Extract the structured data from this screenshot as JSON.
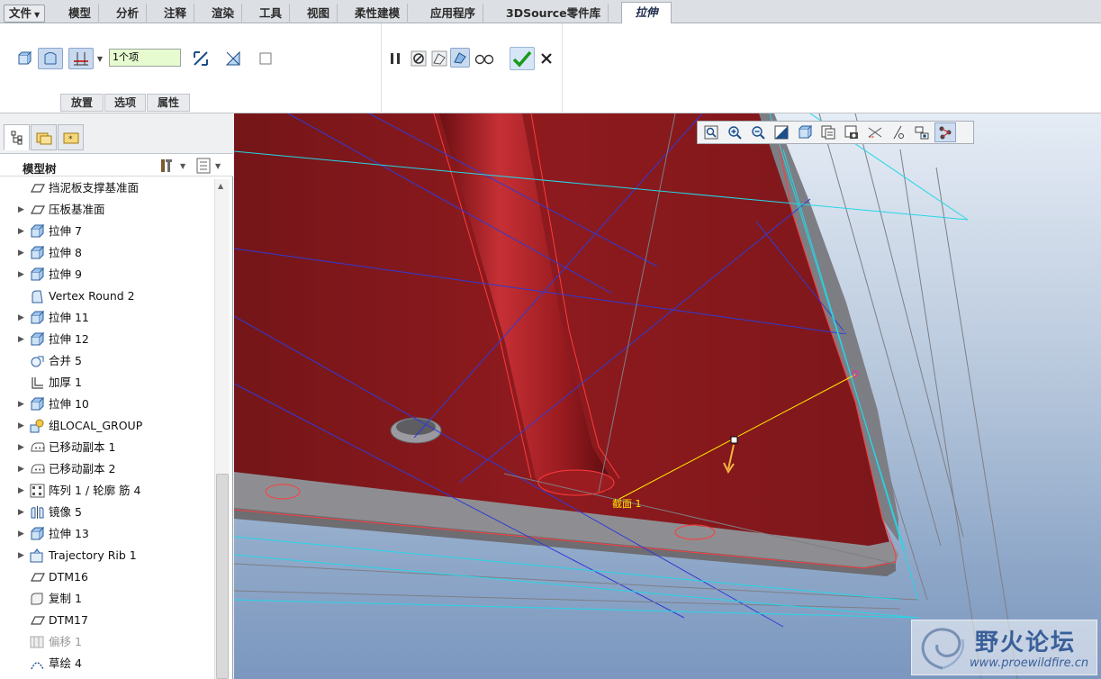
{
  "menu": {
    "file": "文件",
    "tabs": [
      "模型",
      "分析",
      "注释",
      "渲染",
      "工具",
      "视图",
      "柔性建模",
      "应用程序",
      "3DSource零件库"
    ],
    "active_tab": "拉伸"
  },
  "ribbon": {
    "reference_field": "1个项",
    "subtabs": [
      "放置",
      "选项",
      "属性"
    ]
  },
  "navigator": {
    "title": "模型树",
    "items": [
      {
        "label": "挡泥板支撑基准面",
        "icon": "datum-plane-icon",
        "expandable": false
      },
      {
        "label": "压板基准面",
        "icon": "datum-plane-icon",
        "expandable": true
      },
      {
        "label": "拉伸 7",
        "icon": "extrude-icon",
        "expandable": true
      },
      {
        "label": "拉伸 8",
        "icon": "extrude-icon",
        "expandable": true
      },
      {
        "label": "拉伸 9",
        "icon": "extrude-icon",
        "expandable": true
      },
      {
        "label": "Vertex Round 2",
        "icon": "round-icon",
        "expandable": false
      },
      {
        "label": "拉伸 11",
        "icon": "extrude-icon",
        "expandable": true
      },
      {
        "label": "拉伸 12",
        "icon": "extrude-icon",
        "expandable": true
      },
      {
        "label": "合并 5",
        "icon": "merge-icon",
        "expandable": false
      },
      {
        "label": "加厚 1",
        "icon": "thicken-icon",
        "expandable": false
      },
      {
        "label": "拉伸 10",
        "icon": "extrude-icon",
        "expandable": true
      },
      {
        "label": "组LOCAL_GROUP",
        "icon": "group-icon",
        "expandable": true
      },
      {
        "label": "已移动副本 1",
        "icon": "moved-copy-icon",
        "expandable": true
      },
      {
        "label": "已移动副本 2",
        "icon": "moved-copy-icon",
        "expandable": true
      },
      {
        "label": "阵列 1 / 轮廓 筋 4",
        "icon": "pattern-icon",
        "expandable": true
      },
      {
        "label": "镜像 5",
        "icon": "mirror-icon",
        "expandable": true
      },
      {
        "label": "拉伸 13",
        "icon": "extrude-icon",
        "expandable": true
      },
      {
        "label": "Trajectory Rib 1",
        "icon": "rib-icon",
        "expandable": true
      },
      {
        "label": "DTM16",
        "icon": "datum-plane-icon",
        "expandable": false
      },
      {
        "label": "复制 1",
        "icon": "copy-icon",
        "expandable": false
      },
      {
        "label": "DTM17",
        "icon": "datum-plane-icon",
        "expandable": false
      },
      {
        "label": "偏移 1",
        "icon": "offset-icon",
        "expandable": false,
        "dim": true
      },
      {
        "label": "草绘 4",
        "icon": "sketch-icon",
        "expandable": false
      }
    ]
  },
  "viewport": {
    "section_label": "截面 1"
  },
  "watermark": {
    "title": "野火论坛",
    "url": "www.proewildfire.cn"
  },
  "colors": {
    "model_red": "#8e1a1e",
    "edge_red": "#ff3b3b",
    "datum_blue": "#2f3bd6",
    "datum_cyan": "#25d6e6",
    "highlight_yellow": "#ffea00"
  }
}
